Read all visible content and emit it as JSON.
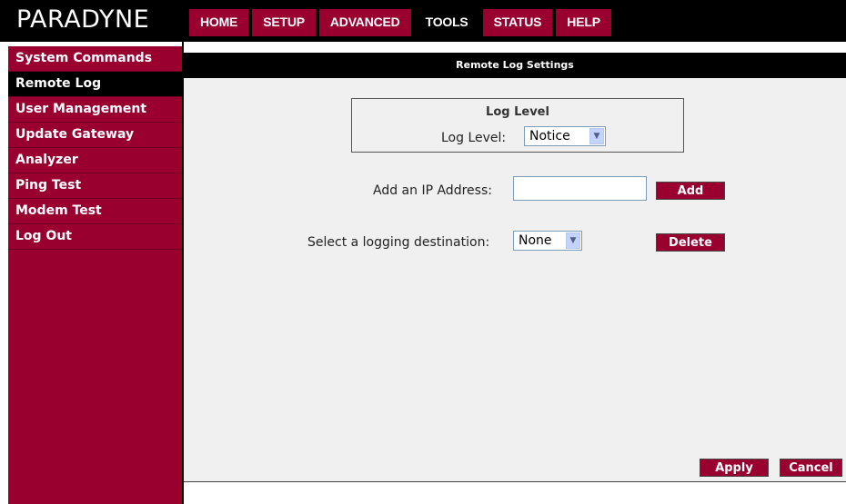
{
  "brand": {
    "logo_text": "PARADYNE"
  },
  "nav": [
    {
      "label": "HOME"
    },
    {
      "label": "SETUP"
    },
    {
      "label": "ADVANCED"
    },
    {
      "label": "TOOLS",
      "active": true
    },
    {
      "label": "STATUS"
    },
    {
      "label": "HELP"
    }
  ],
  "sidebar": {
    "items": [
      {
        "label": "System Commands"
      },
      {
        "label": "Remote Log",
        "active": true
      },
      {
        "label": "User Management"
      },
      {
        "label": "Update Gateway"
      },
      {
        "label": "Analyzer"
      },
      {
        "label": "Ping Test"
      },
      {
        "label": "Modem Test"
      },
      {
        "label": "Log Out"
      }
    ]
  },
  "panel": {
    "title": "Remote Log Settings",
    "log_level": {
      "section_title": "Log Level",
      "label": "Log Level:",
      "selected": "Notice"
    },
    "ip": {
      "label": "Add an IP Address:",
      "value": "",
      "add_label": "Add"
    },
    "destination": {
      "label": "Select a logging destination:",
      "selected": "None",
      "delete_label": "Delete"
    },
    "footer": {
      "apply_label": "Apply",
      "cancel_label": "Cancel"
    }
  },
  "colors": {
    "accent": "#99002f",
    "header_bg": "#000000",
    "panel_bg": "#f0f0f0"
  },
  "icons": {
    "select_arrow": "chevron-down-icon"
  }
}
